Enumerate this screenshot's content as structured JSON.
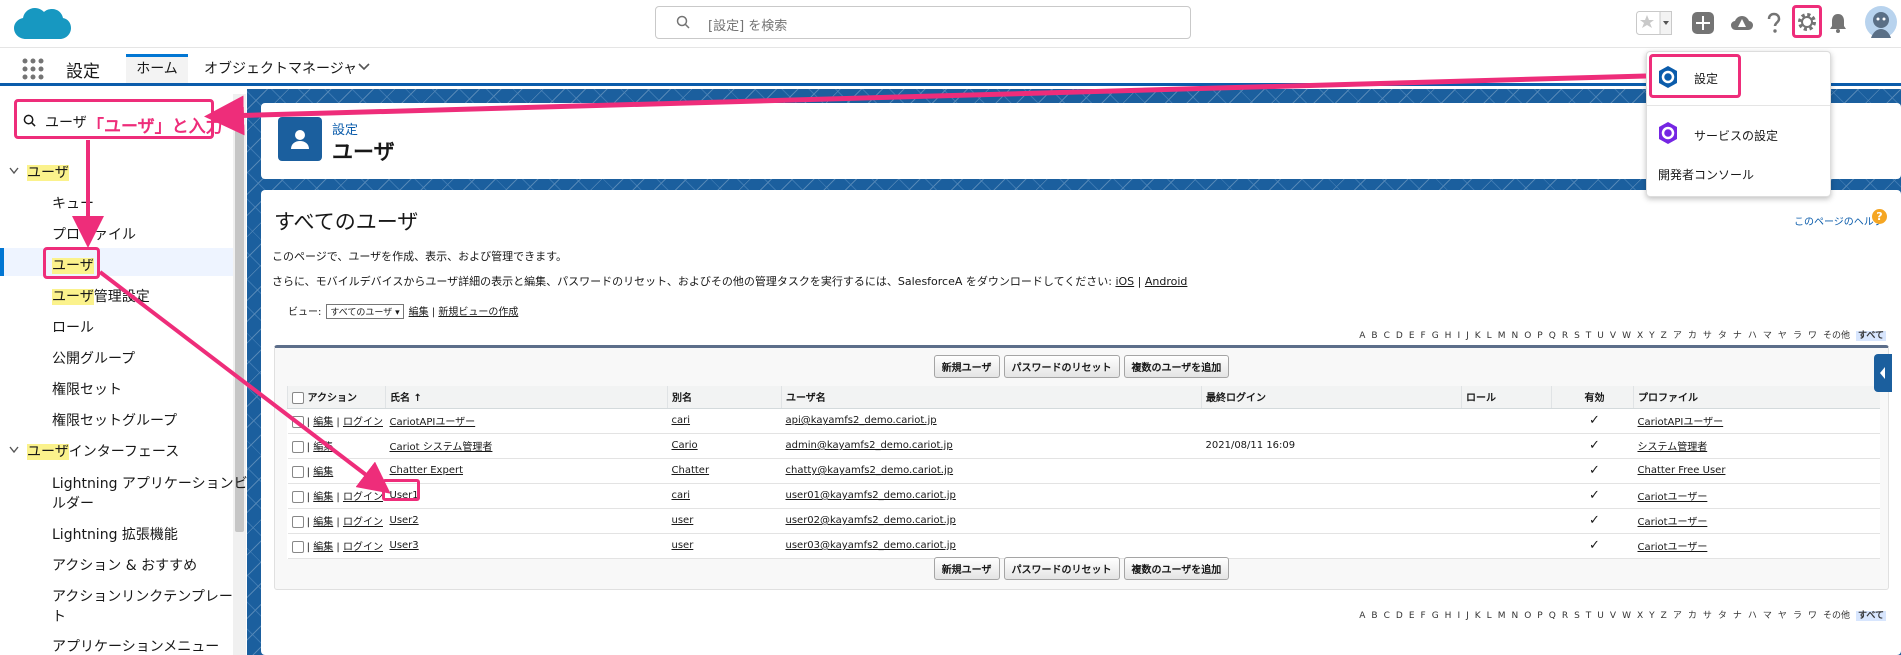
{
  "header": {
    "search_placeholder": "[設定] を検索",
    "colors": {
      "brand": "#0b5cab",
      "accent": "#ee2d7a",
      "header_blue": "#1b5f9e"
    }
  },
  "nav": {
    "app_title": "設定",
    "tabs": [
      {
        "label": "ホーム"
      },
      {
        "label": "オブジェクトマネージャ"
      }
    ]
  },
  "sidebar": {
    "quickfind_value": "ユーザ",
    "annotation": "「ユーザ」と入力",
    "groups": [
      {
        "label_hl": "ユーザ",
        "label_rest": ""
      },
      {
        "label_hl": "ユーザ",
        "label_rest": "インターフェース"
      }
    ],
    "items": [
      {
        "label": "キュー"
      },
      {
        "label": "プロファイル"
      },
      {
        "label": "ユーザ"
      },
      {
        "label_hl": "ユーザ",
        "label_rest": "管理設定"
      },
      {
        "label": "ロール"
      },
      {
        "label": "公開グループ"
      },
      {
        "label": "権限セット"
      },
      {
        "label": "権限セットグループ"
      }
    ],
    "ui_items": [
      {
        "label1": "Lightning アプリケーションビ",
        "label2": "ルダー"
      },
      {
        "label1": "Lightning 拡張機能"
      },
      {
        "label1": "アクション & おすすめ"
      },
      {
        "label1": "アクションリンクテンプレー",
        "label2": "ト"
      },
      {
        "label1": "アプリケーションメニュー"
      }
    ]
  },
  "page": {
    "breadcrumb": "設定",
    "title": "ユーザ",
    "section_title": "すべてのユーザ",
    "help_link": "このページのヘルプ",
    "desc1": "このページで、ユーザを作成、表示、および管理できます。",
    "desc2": "さらに、モバイルデバイスからユーザ詳細の表示と編集、パスワードのリセット、およびその他の管理タスクを実行するには、SalesforceA をダウンロードしてください:",
    "ios": "iOS",
    "sep": "|",
    "android": "Android",
    "view_label": "ビュー:",
    "view_selected": "すべてのユーザ",
    "view_edit": "編集",
    "view_new": "新規ビューの作成"
  },
  "alphabet": [
    "A",
    "B",
    "C",
    "D",
    "E",
    "F",
    "G",
    "H",
    "I",
    "J",
    "K",
    "L",
    "M",
    "N",
    "O",
    "P",
    "Q",
    "R",
    "S",
    "T",
    "U",
    "V",
    "W",
    "X",
    "Y",
    "Z",
    "ア",
    "カ",
    "サ",
    "タ",
    "ナ",
    "ハ",
    "マ",
    "ヤ",
    "ラ",
    "ワ",
    "その他",
    "すべて"
  ],
  "buttons": {
    "new_user": "新規ユーザ",
    "reset_pw": "パスワードのリセット",
    "add_multi": "複数のユーザを追加"
  },
  "table": {
    "headers": {
      "action": "アクション",
      "name": "氏名",
      "sort": "↑",
      "alias": "別名",
      "username": "ユーザ名",
      "last_login": "最終ログイン",
      "role": "ロール",
      "active": "有効",
      "profile": "プロファイル"
    },
    "edit": "編集",
    "login": "ログイン",
    "check": "✓",
    "rows": [
      {
        "name": "CariotAPIユーザー",
        "alias": "cari",
        "username": "api@kayamfs2_demo.cariot.jp",
        "last_login": "",
        "profile": "CariotAPIユーザー",
        "login": true
      },
      {
        "name": "Cariot システム管理者",
        "alias": "Cario",
        "username": "admin@kayamfs2_demo.cariot.jp",
        "last_login": "2021/08/11 16:09",
        "profile": "システム管理者",
        "login": false
      },
      {
        "name": "Chatter Expert",
        "alias": "Chatter",
        "username": "chatty@kayamfs2_demo.cariot.jp",
        "last_login": "",
        "profile": "Chatter Free User",
        "login": false
      },
      {
        "name": "User1",
        "alias": "cari",
        "username": "user01@kayamfs2_demo.cariot.jp",
        "last_login": "",
        "profile": "Cariotユーザー",
        "login": true
      },
      {
        "name": "User2",
        "alias": "user",
        "username": "user02@kayamfs2_demo.cariot.jp",
        "last_login": "",
        "profile": "Cariotユーザー",
        "login": true
      },
      {
        "name": "User3",
        "alias": "user",
        "username": "user03@kayamfs2_demo.cariot.jp",
        "last_login": "",
        "profile": "Cariotユーザー",
        "login": true
      }
    ]
  },
  "dropdown": {
    "setup": "設定",
    "service_setup": "サービスの設定",
    "dev_console": "開発者コンソール"
  }
}
